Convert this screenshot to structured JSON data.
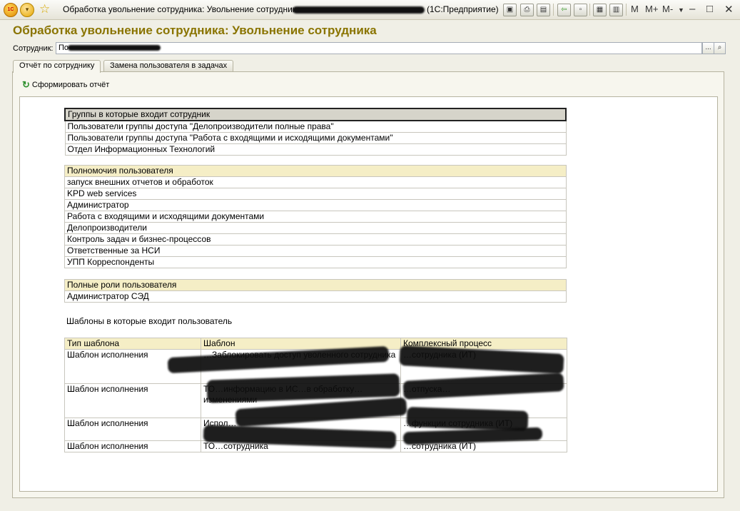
{
  "window": {
    "title_start": "Обработка увольнение сотрудника: Увольнение сотрудника -",
    "title_end": "(1С:Предприятие)",
    "logo_text": "1С",
    "toolbar": {
      "mem_m": "M",
      "mem_mplus": "M+",
      "mem_mminus": "M-",
      "min": "–",
      "max": "□",
      "close": "✕"
    }
  },
  "form": {
    "title": "Обработка увольнение сотрудника: Увольнение сотрудника",
    "employee_label": "Сотрудник:",
    "employee_value": "По",
    "select_btn": "...",
    "search_btn": "🔍"
  },
  "tabs": [
    "Отчёт по сотруднику",
    "Замена пользователя в задачах"
  ],
  "refresh_button": "Сформировать отчёт",
  "report": {
    "groups": {
      "header": "Группы в которые входит сотрудник",
      "rows": [
        "Пользователи группы доступа \"Делопроизводители полные права\"",
        "Пользователи группы доступа \"Работа с входящими и исходящими документами\"",
        "Отдел Информационных Технологий"
      ]
    },
    "permissions": {
      "header": "Полномочия пользователя",
      "rows": [
        "запуск внешних отчетов и обработок",
        "KPD web services",
        "Администратор",
        "Работа с входящими и исходящими документами",
        "Делопроизводители",
        "Контроль задач и бизнес-процессов",
        "Ответственные за НСИ",
        "УПП Корреспонденты"
      ]
    },
    "roles": {
      "header": "Полные роли пользователя",
      "rows": [
        "Администратор СЭД"
      ]
    },
    "templates_caption": "Шаблоны в которые входит пользователь",
    "templates": {
      "columns": [
        "Тип шаблона",
        "Шаблон",
        "Комплексный процесс"
      ],
      "rows": [
        {
          "type": "Шаблон исполнения",
          "template": "…Заблокировать доступ уволенного сотрудника",
          "process": "…сотрудника (ИТ)"
        },
        {
          "type": "Шаблон исполнения",
          "template": "ТО…информацию в ИС…в обработку…изменениями",
          "process": "…отпуска…"
        },
        {
          "type": "Шаблон исполнения",
          "template": "Испол…",
          "process": "…функции сотрудника (ИТ)"
        },
        {
          "type": "Шаблон исполнения",
          "template": "ТО…сотрудника",
          "process": "…сотрудника (ИТ)"
        }
      ]
    }
  },
  "colors": {
    "title_gold": "#8a7400",
    "section_header_bg": "#f5eec6",
    "selected_header_bg": "#d6d4ca",
    "window_bg": "#f0efe6"
  }
}
